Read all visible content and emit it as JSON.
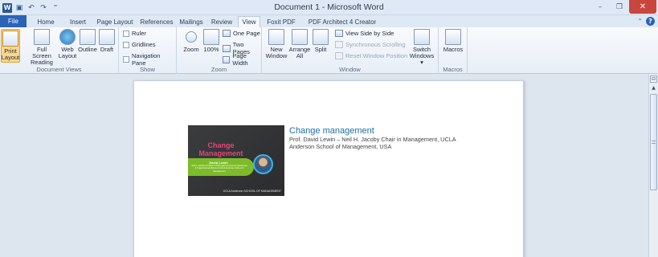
{
  "window": {
    "title": "Document 1 - Microsoft Word",
    "minimize": "–",
    "maximize": "❐",
    "close": "✕"
  },
  "qat": {
    "word": "W",
    "save": "▣",
    "undo": "↶",
    "redo": "↷",
    "customize": "⁼"
  },
  "tabs": {
    "file": "File",
    "home": "Home",
    "insert": "Insert",
    "page_layout": "Page Layout",
    "references": "References",
    "mailings": "Mailings",
    "review": "Review",
    "view": "View",
    "foxit": "Foxit PDF",
    "pdf_architect": "PDF Architect 4 Creator"
  },
  "help": {
    "minimize_ribbon": "⌃",
    "help": "?"
  },
  "ribbon": {
    "document_views": {
      "label": "Document Views",
      "print_layout": "Print Layout",
      "full_screen_reading": "Full Screen Reading",
      "web_layout": "Web Layout",
      "outline": "Outline",
      "draft": "Draft"
    },
    "show": {
      "label": "Show",
      "ruler": "Ruler",
      "gridlines": "Gridlines",
      "navigation_pane": "Navigation Pane"
    },
    "zoom": {
      "label": "Zoom",
      "zoom": "Zoom",
      "hundred": "100%",
      "one_page": "One Page",
      "two_pages": "Two Pages",
      "page_width": "Page Width"
    },
    "window": {
      "label": "Window",
      "new_window": "New Window",
      "arrange_all": "Arrange All",
      "split": "Split",
      "view_side_by_side": "View Side by Side",
      "synchronous_scrolling": "Synchronous Scrolling",
      "reset_window_position": "Reset Window Position",
      "switch_windows": "Switch Windows ▾"
    },
    "macros": {
      "label": "Macros",
      "macros": "Macros"
    }
  },
  "document": {
    "entry_title": "Change management",
    "entry_description": "Prof. David Lewin – Neil H. Jacoby Chair in Management, UCLA Anderson School of Management, USA",
    "thumbnail": {
      "title": "Change Management",
      "speaker": "David Lewin",
      "speaker_detail": "Neil H. Jacoby Professor of Management Human Resources & Organizational Behavior UCLA Anderson School of Management",
      "logo": "UCLA Anderson SCHOOL OF MANAGEMENT"
    }
  },
  "scrollbar": {
    "ruler_toggle": "⊟",
    "up_arrow": "▲"
  }
}
